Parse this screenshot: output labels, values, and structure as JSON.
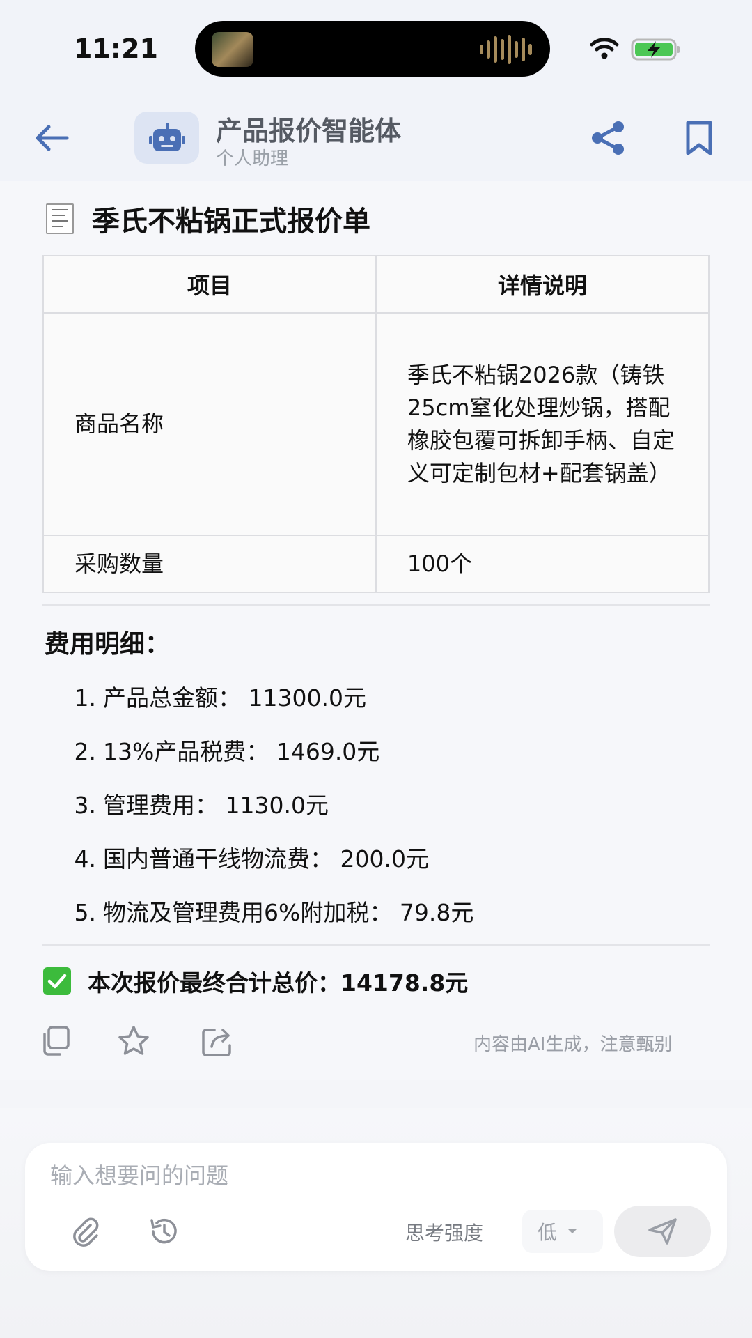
{
  "status_bar": {
    "time": "11:21"
  },
  "header": {
    "agent_name": "产品报价智能体",
    "agent_subtitle": "个人助理",
    "accent_color": "#4a6fb5"
  },
  "quote": {
    "title": "季氏不粘锅正式报价单",
    "table": {
      "headers": [
        "项目",
        "详情说明"
      ],
      "rows": [
        {
          "item": "商品名称",
          "detail": "季氏不粘锅2026款（铸铁25cm窒化处理炒锅，搭配橡胶包覆可拆卸手柄、自定义可定制包材+配套锅盖）"
        },
        {
          "item": "采购数量",
          "detail": "100个"
        }
      ]
    },
    "fees_title": "费用明细：",
    "fees": [
      {
        "num": "1.",
        "text": "产品总金额：  11300.0元"
      },
      {
        "num": "2.",
        "text": "13%产品税费：  1469.0元"
      },
      {
        "num": "3.",
        "text": "管理费用：  1130.0元"
      },
      {
        "num": "4.",
        "text": "国内普通干线物流费：  200.0元"
      },
      {
        "num": "5.",
        "text": "物流及管理费用6%附加税：  79.8元"
      }
    ],
    "total": "本次报价最终合计总价：14178.8元"
  },
  "message_actions": {
    "disclaimer": "内容由AI生成，注意甄别"
  },
  "composer": {
    "placeholder": "输入想要问的问题",
    "thinking_label": "思考强度",
    "thinking_level": "低"
  }
}
